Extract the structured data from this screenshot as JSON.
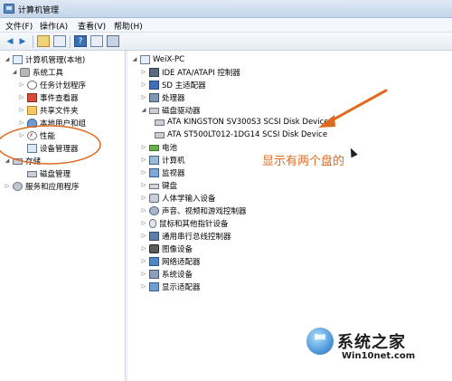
{
  "window": {
    "title": "计算机管理"
  },
  "menu": {
    "file": "文件(F)",
    "action": "操作(A)",
    "view": "查看(V)",
    "help": "帮助(H)"
  },
  "left_tree": {
    "root": "计算机管理(本地)",
    "system_tools": "系统工具",
    "task_scheduler": "任务计划程序",
    "event_viewer": "事件查看器",
    "shared_folders": "共享文件夹",
    "local_users": "本地用户和组",
    "performance": "性能",
    "device_manager": "设备管理器",
    "storage": "存储",
    "disk_management": "磁盘管理",
    "services_apps": "服务和应用程序"
  },
  "right_tree": {
    "computer_name": "WeiX-PC",
    "ide": "IDE ATA/ATAPI 控制器",
    "sd": "SD 主适配器",
    "cpu": "处理器",
    "disk_drives": "磁盘驱动器",
    "disk1": "ATA KINGSTON SV300S3 SCSI Disk Device",
    "disk2": "ATA ST500LT012-1DG14 SCSI Disk Device",
    "battery": "电池",
    "computer": "计算机",
    "monitors": "监视器",
    "keyboard": "键盘",
    "hid": "人体学输入设备",
    "sound": "声音、视频和游戏控制器",
    "mouse": "鼠标和其他指针设备",
    "usb": "通用串行总线控制器",
    "imaging": "图像设备",
    "network": "网络适配器",
    "system_devices": "系统设备",
    "display": "显示适配器"
  },
  "annotation": {
    "text": "显示有两个盘的"
  },
  "watermark": {
    "title": "系统之家",
    "url": "Win10net.com"
  },
  "colors": {
    "annotation": "#e06a1f",
    "selection": "#cfe3fb"
  }
}
